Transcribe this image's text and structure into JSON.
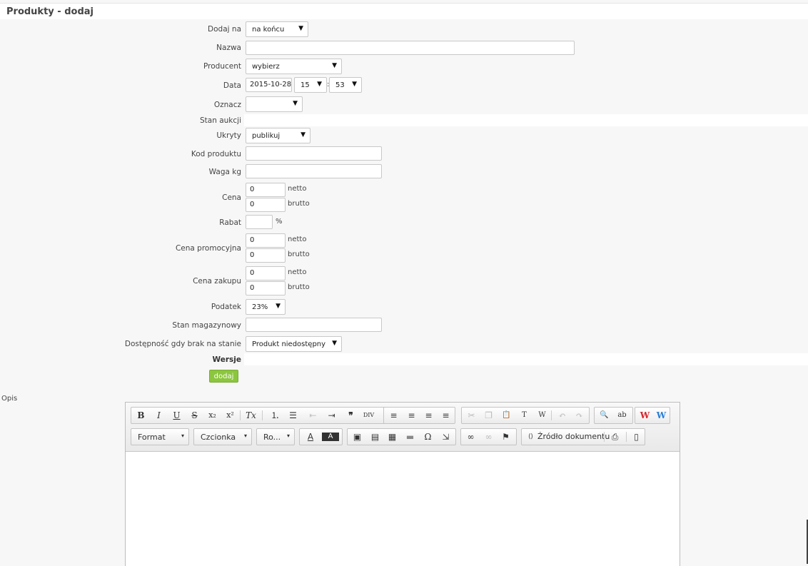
{
  "header": {
    "title": "Produkty - dodaj"
  },
  "form": {
    "dodaj_na": {
      "label": "Dodaj na",
      "value": "na końcu"
    },
    "nazwa": {
      "label": "Nazwa",
      "value": ""
    },
    "producent": {
      "label": "Producent",
      "value": "wybierz"
    },
    "data": {
      "label": "Data",
      "date": "2015-10-28",
      "hour": "15",
      "sep": ":",
      "minute": "53"
    },
    "oznacz": {
      "label": "Oznacz",
      "value": ""
    },
    "stan_aukcji": {
      "label": "Stan aukcji"
    },
    "ukryty": {
      "label": "Ukryty",
      "value": "publikuj"
    },
    "kod_produktu": {
      "label": "Kod produktu",
      "value": ""
    },
    "waga": {
      "label": "Waga kg",
      "value": ""
    },
    "cena": {
      "label": "Cena",
      "netto": "0",
      "brutto": "0"
    },
    "rabat": {
      "label": "Rabat",
      "value": "",
      "unit": "%"
    },
    "cena_promocyjna": {
      "label": "Cena promocyjna",
      "netto": "0",
      "brutto": "0"
    },
    "cena_zakupu": {
      "label": "Cena zakupu",
      "netto": "0",
      "brutto": "0"
    },
    "podatek": {
      "label": "Podatek",
      "value": "23%"
    },
    "stan_magazynowy": {
      "label": "Stan magazynowy",
      "value": ""
    },
    "dostepnosc": {
      "label": "Dostępność gdy brak na stanie",
      "value": "Produkt niedostępny"
    },
    "wersje": {
      "label": "Wersje"
    },
    "units": {
      "netto": "netto",
      "brutto": "brutto"
    },
    "add_button": "dodaj"
  },
  "editor": {
    "label": "Opis",
    "combos": {
      "format": "Format",
      "font": "Czcionka",
      "size": "Ro..."
    },
    "source_label": "Źródło dokumentu",
    "glyphs": {
      "bold": "B",
      "italic": "I",
      "underline": "U",
      "strike": "S",
      "subscript": "x₂",
      "superscript": "x²",
      "remove_format": "Tx",
      "numbered_list": "⒈",
      "bullet_list": "☰",
      "outdent": "⇤",
      "indent": "⇥",
      "blockquote": "❞",
      "div": "DIV",
      "align_left": "≡",
      "align_center": "≡",
      "align_right": "≡",
      "justify": "≡",
      "cut": "✂",
      "copy": "❐",
      "paste": "📋",
      "paste_text": "T",
      "paste_word": "W",
      "undo": "↶",
      "redo": "↷",
      "find": "🔍",
      "replace": "ab",
      "spell_w_red": "W",
      "spell_w_blue": "W",
      "text_color": "A",
      "bg_color": "A",
      "image": "▣",
      "flash": "▤",
      "table": "▦",
      "hr": "▬",
      "special_char": "Ω",
      "page_break": "⇲",
      "link": "∞",
      "unlink": "∞",
      "anchor": "⚑",
      "source": "⟨⟩",
      "preview": "⎙",
      "templates": "▯"
    }
  },
  "colors": {
    "accent_button": "#8cc63e",
    "spell_red": "#d9232d",
    "spell_blue": "#2a7fd4"
  }
}
